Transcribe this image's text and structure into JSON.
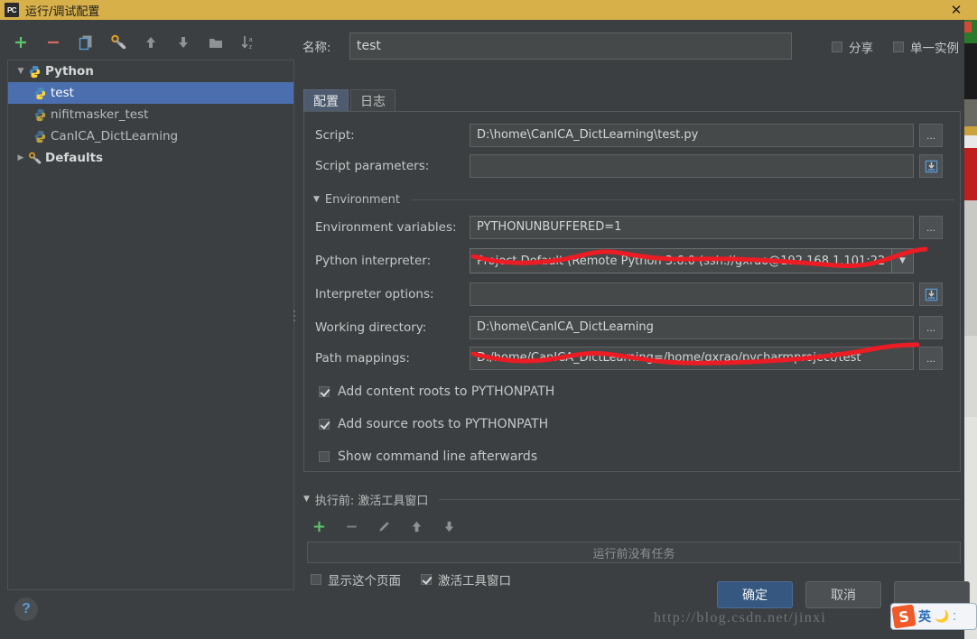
{
  "window": {
    "title": "运行/调试配置",
    "app_icon": "PC",
    "close_icon": "close-icon"
  },
  "left_panel": {
    "toolbar": [
      {
        "name": "add-configuration-button",
        "glyph": "+"
      },
      {
        "name": "remove-configuration-button",
        "glyph": "−"
      },
      {
        "name": "copy-configuration-button",
        "glyph": "copy-icon"
      },
      {
        "name": "edit-templates-button",
        "glyph": "wrench-icon"
      },
      {
        "name": "move-up-button",
        "glyph": "↑"
      },
      {
        "name": "move-down-button",
        "glyph": "↓"
      },
      {
        "name": "new-folder-button",
        "glyph": "folder-icon"
      },
      {
        "name": "sort-alphabetically-button",
        "glyph": "sort-az-icon"
      }
    ],
    "tree": [
      {
        "label": "Python",
        "type": "group",
        "expanded": true,
        "icon": "python-icon",
        "selected": false
      },
      {
        "label": "test",
        "type": "item",
        "icon": "python-icon",
        "selected": true
      },
      {
        "label": "nifitmasker_test",
        "type": "item",
        "icon": "python-icon",
        "selected": false
      },
      {
        "label": "CanICA_DictLearning",
        "type": "item",
        "icon": "python-icon",
        "selected": false
      },
      {
        "label": "Defaults",
        "type": "group",
        "expanded": false,
        "icon": "wrench-icon",
        "selected": false
      }
    ],
    "help_label": "?"
  },
  "header": {
    "name_label": "名称:",
    "name_value": "test",
    "share": {
      "label": "分享",
      "checked": false
    },
    "single_instance": {
      "label": "单一实例",
      "checked": false
    }
  },
  "tabs": [
    {
      "label": "配置",
      "active": true
    },
    {
      "label": "日志",
      "active": false
    }
  ],
  "form": {
    "script": {
      "label": "Script:",
      "value": "D:\\home\\CanICA_DictLearning\\test.py",
      "browse": "..."
    },
    "script_parameters": {
      "label": "Script parameters:",
      "value": "",
      "placeholder": "",
      "macro": "expand-macros-icon"
    },
    "environment_section": "Environment",
    "environment_variables": {
      "label": "Environment variables:",
      "value": "PYTHONUNBUFFERED=1",
      "browse": "..."
    },
    "python_interpreter": {
      "label": "Python interpreter:",
      "value": "Project Default (Remote Python 3.6.0 (ssh://gxrao@192.168.1.101:22",
      "arrow": "chevron-down-icon"
    },
    "interpreter_options": {
      "label": "Interpreter options:",
      "value": "",
      "macro": "expand-macros-icon"
    },
    "working_directory": {
      "label": "Working directory:",
      "value": "D:\\home\\CanICA_DictLearning",
      "browse": "..."
    },
    "path_mappings": {
      "label": "Path mappings:",
      "value": "D:/home/CanICA_DictLearning=/home/gxrao/pycharmproject/test",
      "browse": "..."
    },
    "checkboxes": [
      {
        "label": "Add content roots to PYTHONPATH",
        "checked": true
      },
      {
        "label": "Add source roots to PYTHONPATH",
        "checked": true
      },
      {
        "label": "Show command line afterwards",
        "checked": false
      }
    ]
  },
  "before_launch": {
    "section_label": "执行前: 激活工具窗口",
    "toolbar": [
      {
        "name": "add-task-button",
        "glyph": "+"
      },
      {
        "name": "remove-task-button",
        "glyph": "−"
      },
      {
        "name": "edit-task-button",
        "glyph": "pencil-icon"
      },
      {
        "name": "move-task-up-button",
        "glyph": "↑"
      },
      {
        "name": "move-task-down-button",
        "glyph": "↓"
      }
    ],
    "empty_text": "运行前没有任务",
    "show_page": {
      "label": "显示这个页面",
      "checked": false
    },
    "activate_tool_window": {
      "label": "激活工具窗口",
      "checked": true
    }
  },
  "footer": {
    "ok_label": "确定",
    "cancel_label": "取消",
    "apply_label": ""
  },
  "watermark": "http://blog.csdn.net/jinxi",
  "ime": {
    "logo": "S",
    "mode": "英",
    "moon_icon": "moon-icon",
    "dots_icon": "dots-icon"
  },
  "colors": {
    "titlebar": "#d7b049",
    "selection": "#4b6eaf",
    "primary_button": "#365880",
    "annotation": "#ec1c24",
    "panel": "#3c3f41",
    "field": "#45494a"
  }
}
